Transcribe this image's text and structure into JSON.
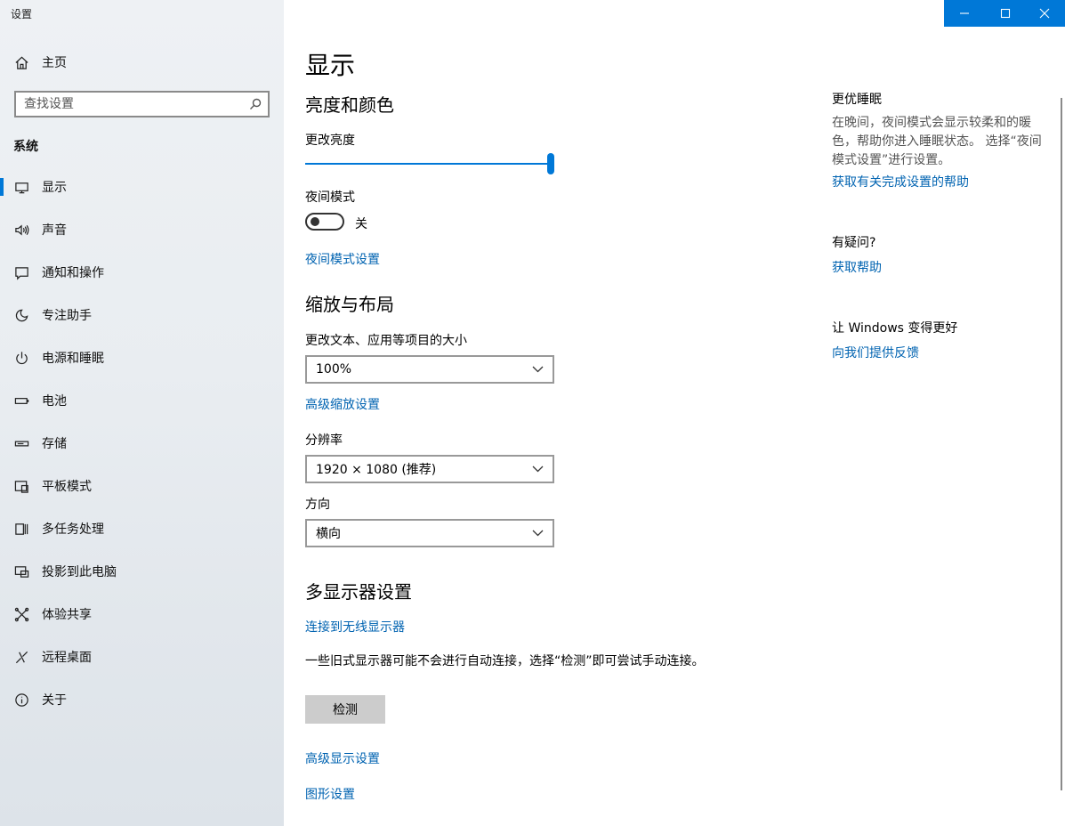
{
  "window": {
    "title": "设置"
  },
  "titlebar": {
    "minimize_icon": "minimize-icon",
    "maximize_icon": "maximize-icon",
    "close_icon": "close-icon",
    "accent": "#0078d7"
  },
  "sidebar": {
    "home_label": "主页",
    "search_placeholder": "查找设置",
    "section_label": "系统",
    "items": [
      {
        "label": "显示",
        "icon": "monitor-icon",
        "active": true
      },
      {
        "label": "声音",
        "icon": "speaker-icon"
      },
      {
        "label": "通知和操作",
        "icon": "notification-icon"
      },
      {
        "label": "专注助手",
        "icon": "moon-icon"
      },
      {
        "label": "电源和睡眠",
        "icon": "power-icon"
      },
      {
        "label": "电池",
        "icon": "battery-icon"
      },
      {
        "label": "存储",
        "icon": "storage-icon"
      },
      {
        "label": "平板模式",
        "icon": "tablet-icon"
      },
      {
        "label": "多任务处理",
        "icon": "multitask-icon"
      },
      {
        "label": "投影到此电脑",
        "icon": "project-icon"
      },
      {
        "label": "体验共享",
        "icon": "share-icon"
      },
      {
        "label": "远程桌面",
        "icon": "remote-icon"
      },
      {
        "label": "关于",
        "icon": "info-icon"
      }
    ]
  },
  "main": {
    "title": "显示",
    "brightness_section": "亮度和颜色",
    "brightness_label": "更改亮度",
    "brightness_level": 1.0,
    "night_mode_label": "夜间模式",
    "night_mode_state": "关",
    "night_mode_link": "夜间模式设置",
    "scale_section": "缩放与布局",
    "scale_label": "更改文本、应用等项目的大小",
    "scale_value": "100%",
    "advanced_scale_link": "高级缩放设置",
    "resolution_label": "分辨率",
    "resolution_value": "1920 × 1080 (推荐)",
    "orientation_label": "方向",
    "orientation_value": "横向",
    "multi_display_section": "多显示器设置",
    "wireless_link": "连接到无线显示器",
    "detect_text": "一些旧式显示器可能不会进行自动连接，选择“检测”即可尝试手动连接。",
    "detect_button": "检测",
    "advanced_display_link": "高级显示设置",
    "graphics_link": "图形设置"
  },
  "right": {
    "sleep_heading": "更优睡眠",
    "sleep_text": "在晚间，夜间模式会显示较柔和的暖色，帮助你进入睡眠状态。 选择“夜间模式设置”进行设置。",
    "sleep_link": "获取有关完成设置的帮助",
    "question_heading": "有疑问?",
    "help_link": "获取帮助",
    "better_heading": "让 Windows 变得更好",
    "feedback_link": "向我们提供反馈"
  }
}
